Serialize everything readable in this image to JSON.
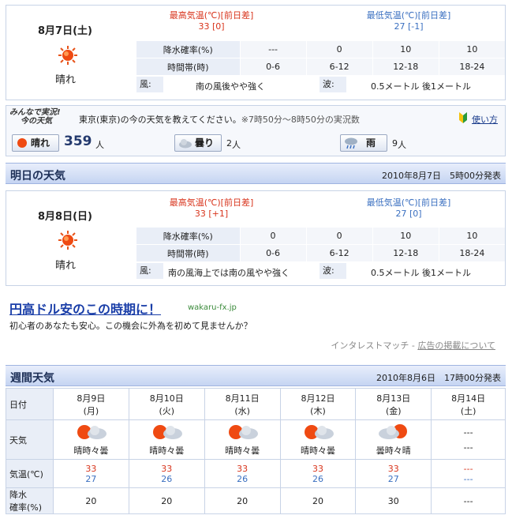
{
  "today": {
    "date": "8月7日(土)",
    "condition": "晴れ",
    "high_label": "最高気温(℃)[前日差]",
    "high_value": "33 [0]",
    "low_label": "最低気温(℃)[前日差]",
    "low_value": "27 [-1]",
    "precip_label": "降水確率(%)",
    "precip": [
      "---",
      "0",
      "10",
      "10"
    ],
    "time_label": "時間帯(時)",
    "times": [
      "0-6",
      "6-12",
      "12-18",
      "18-24"
    ],
    "wind_label": "風:",
    "wind": "南の風後やや強く",
    "wave_label": "波:",
    "wave": "0.5メートル 後1メートル"
  },
  "minna": {
    "logo_line1": "みんなで実況!",
    "logo_line2": "今の天気",
    "prompt": "東京(東京)の今の天気を教えてください。",
    "note": "※7時50分～8時50分の実況数",
    "help": "使い方",
    "votes": [
      {
        "label": "晴れ",
        "count": "359",
        "unit": "人"
      },
      {
        "label": "曇り",
        "count": "2",
        "unit": "人"
      },
      {
        "label": "雨",
        "count": "9",
        "unit": "人"
      }
    ]
  },
  "tomorrow_header": {
    "title": "明日の天気",
    "issued": "2010年8月7日　5時00分発表"
  },
  "tomorrow": {
    "date": "8月8日(日)",
    "condition": "晴れ",
    "high_label": "最高気温(℃)[前日差]",
    "high_value": "33 [+1]",
    "low_label": "最低気温(℃)[前日差]",
    "low_value": "27 [0]",
    "precip_label": "降水確率(%)",
    "precip": [
      "0",
      "0",
      "10",
      "10"
    ],
    "time_label": "時間帯(時)",
    "times": [
      "0-6",
      "6-12",
      "12-18",
      "18-24"
    ],
    "wind_label": "風:",
    "wind": "南の風海上では南の風やや強く",
    "wave_label": "波:",
    "wave": "0.5メートル 後1メートル"
  },
  "ad": {
    "title": "円高ドル安のこの時期に！",
    "domain": "wakaru-fx.jp",
    "body": "初心者のあなたも安心。この機会に外為を初めて見ませんか？",
    "footer_left": "インタレストマッチ",
    "footer_sep": " - ",
    "footer_link": "広告の掲載について"
  },
  "weekly_header": {
    "title": "週間天気",
    "issued": "2010年8月6日　17時00分発表"
  },
  "weekly": {
    "row_labels": {
      "date": "日付",
      "weather": "天気",
      "temp": "気温(℃)",
      "precip_line1": "降水",
      "precip_line2": "確率(%)"
    },
    "days": [
      {
        "date": "8月9日",
        "dow": "(月)",
        "weather": "晴時々曇",
        "icon": "sun-cloud-icon",
        "high": "33",
        "low": "27",
        "precip": "20"
      },
      {
        "date": "8月10日",
        "dow": "(火)",
        "weather": "晴時々曇",
        "icon": "sun-cloud-icon",
        "high": "33",
        "low": "26",
        "precip": "20"
      },
      {
        "date": "8月11日",
        "dow": "(水)",
        "weather": "晴時々曇",
        "icon": "sun-cloud-icon",
        "high": "33",
        "low": "26",
        "precip": "20"
      },
      {
        "date": "8月12日",
        "dow": "(木)",
        "weather": "晴時々曇",
        "icon": "sun-cloud-icon",
        "high": "33",
        "low": "26",
        "precip": "20"
      },
      {
        "date": "8月13日",
        "dow": "(金)",
        "weather": "曇時々晴",
        "icon": "cloud-sun-icon",
        "high": "33",
        "low": "27",
        "precip": "30"
      },
      {
        "date": "8月14日",
        "dow": "(土)",
        "weather": "---",
        "weather2": "---",
        "icon": "",
        "high": "---",
        "low": "---",
        "precip": "---"
      }
    ]
  },
  "colors": {
    "high": "#d8341c",
    "low": "#3a6fc0",
    "header_bg": "#c5d4f2",
    "label_bg": "#e9eef7"
  }
}
